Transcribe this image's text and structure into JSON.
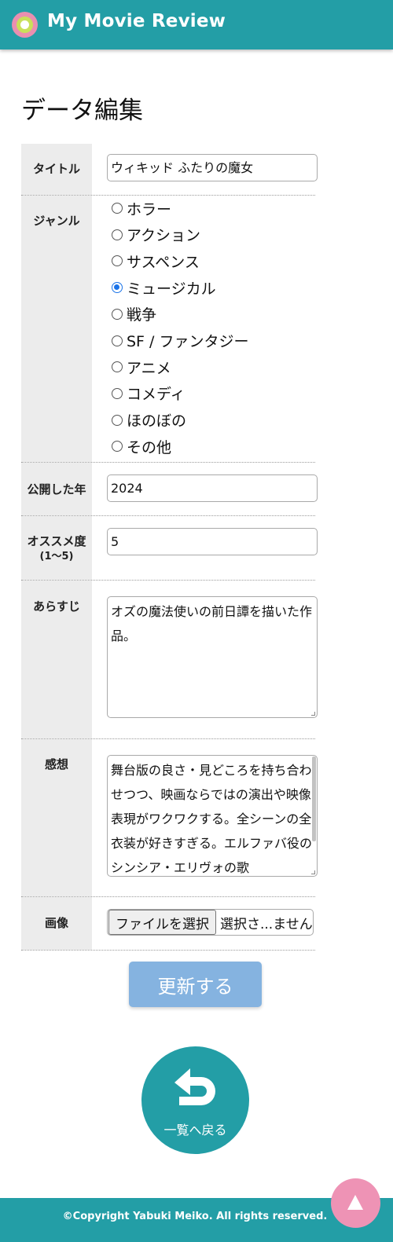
{
  "header": {
    "site_title": "My Movie Review"
  },
  "page_title": "データ編集",
  "form": {
    "title": {
      "label": "タイトル",
      "value": "ウィキッド ふたりの魔女"
    },
    "genre": {
      "label": "ジャンル",
      "options": [
        "ホラー",
        "アクション",
        "サスペンス",
        "ミュージカル",
        "戦争",
        "SF / ファンタジー",
        "アニメ",
        "コメディ",
        "ほのぼの",
        "その他"
      ],
      "selected": "ミュージカル"
    },
    "year": {
      "label": "公開した年",
      "value": "2024"
    },
    "rating": {
      "label": "オススメ度",
      "sublabel": "(1〜5)",
      "value": "5"
    },
    "synopsis": {
      "label": "あらすじ",
      "value": "オズの魔法使いの前日譚を描いた作品。"
    },
    "impression": {
      "label": "感想",
      "value": "舞台版の良さ・見どころを持ち合わせつつ、映画ならではの演出や映像表現がワクワクする。全シーンの全衣装が好きすぎる。エルファバ役のシンシア・エリヴォの歌"
    },
    "image": {
      "label": "画像",
      "button": "ファイルを選択",
      "status": "選択さ...ません"
    },
    "submit_label": "更新する"
  },
  "back_label": "一覧へ戻る",
  "footer": {
    "copyright": "©Copyright Yabuki Meiko. All rights reserved."
  },
  "colors": {
    "brand": "#239ea6",
    "submit": "#85b3e0",
    "accent_pink": "#ee93b5"
  },
  "icons": {
    "back": "return-arrow-icon",
    "to_top": "arrow-up-icon"
  }
}
